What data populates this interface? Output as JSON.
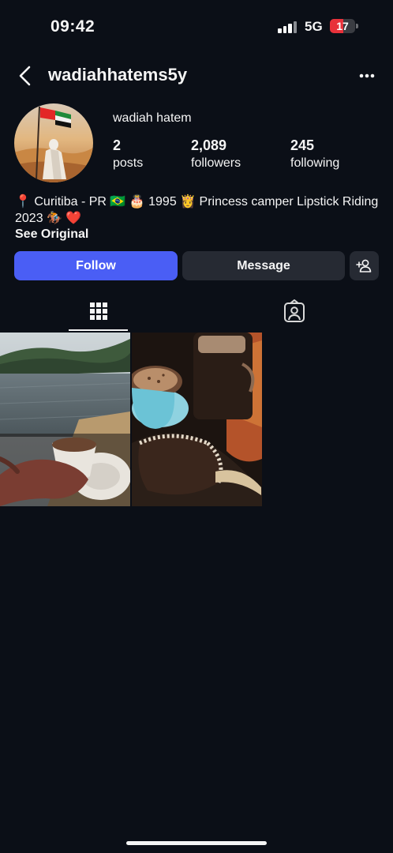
{
  "status_bar": {
    "time": "09:42",
    "network": "5G",
    "battery_level": "17",
    "battery_fraction": 0.17,
    "battery_color": "#e8313a"
  },
  "header": {
    "username": "wadiahhatems5y",
    "back_icon": "chevron-left-icon",
    "more_icon": "more-horizontal-icon"
  },
  "profile": {
    "display_name": "wadiah hatem",
    "stats": {
      "posts": {
        "value": "2",
        "label": "posts"
      },
      "followers": {
        "value": "2,089",
        "label": "followers"
      },
      "following": {
        "value": "245",
        "label": "following"
      }
    },
    "bio": "📍 Curitiba - PR 🇧🇷 🎂 1995 👸 Princess camper Lipstick Riding 2023 🏇 ❤️",
    "see_original": "See Original"
  },
  "actions": {
    "follow_label": "Follow",
    "message_label": "Message",
    "add_icon": "add-person-icon",
    "follow_color": "#4a5ef5"
  },
  "tabs": {
    "grid_icon": "grid-icon",
    "tagged_icon": "tagged-person-icon",
    "active": "grid"
  },
  "posts": [
    {
      "name": "coffee-lake-photo"
    },
    {
      "name": "cappuccino-photo"
    }
  ],
  "colors": {
    "background": "#0b0f17",
    "secondary_button": "#262a33"
  }
}
